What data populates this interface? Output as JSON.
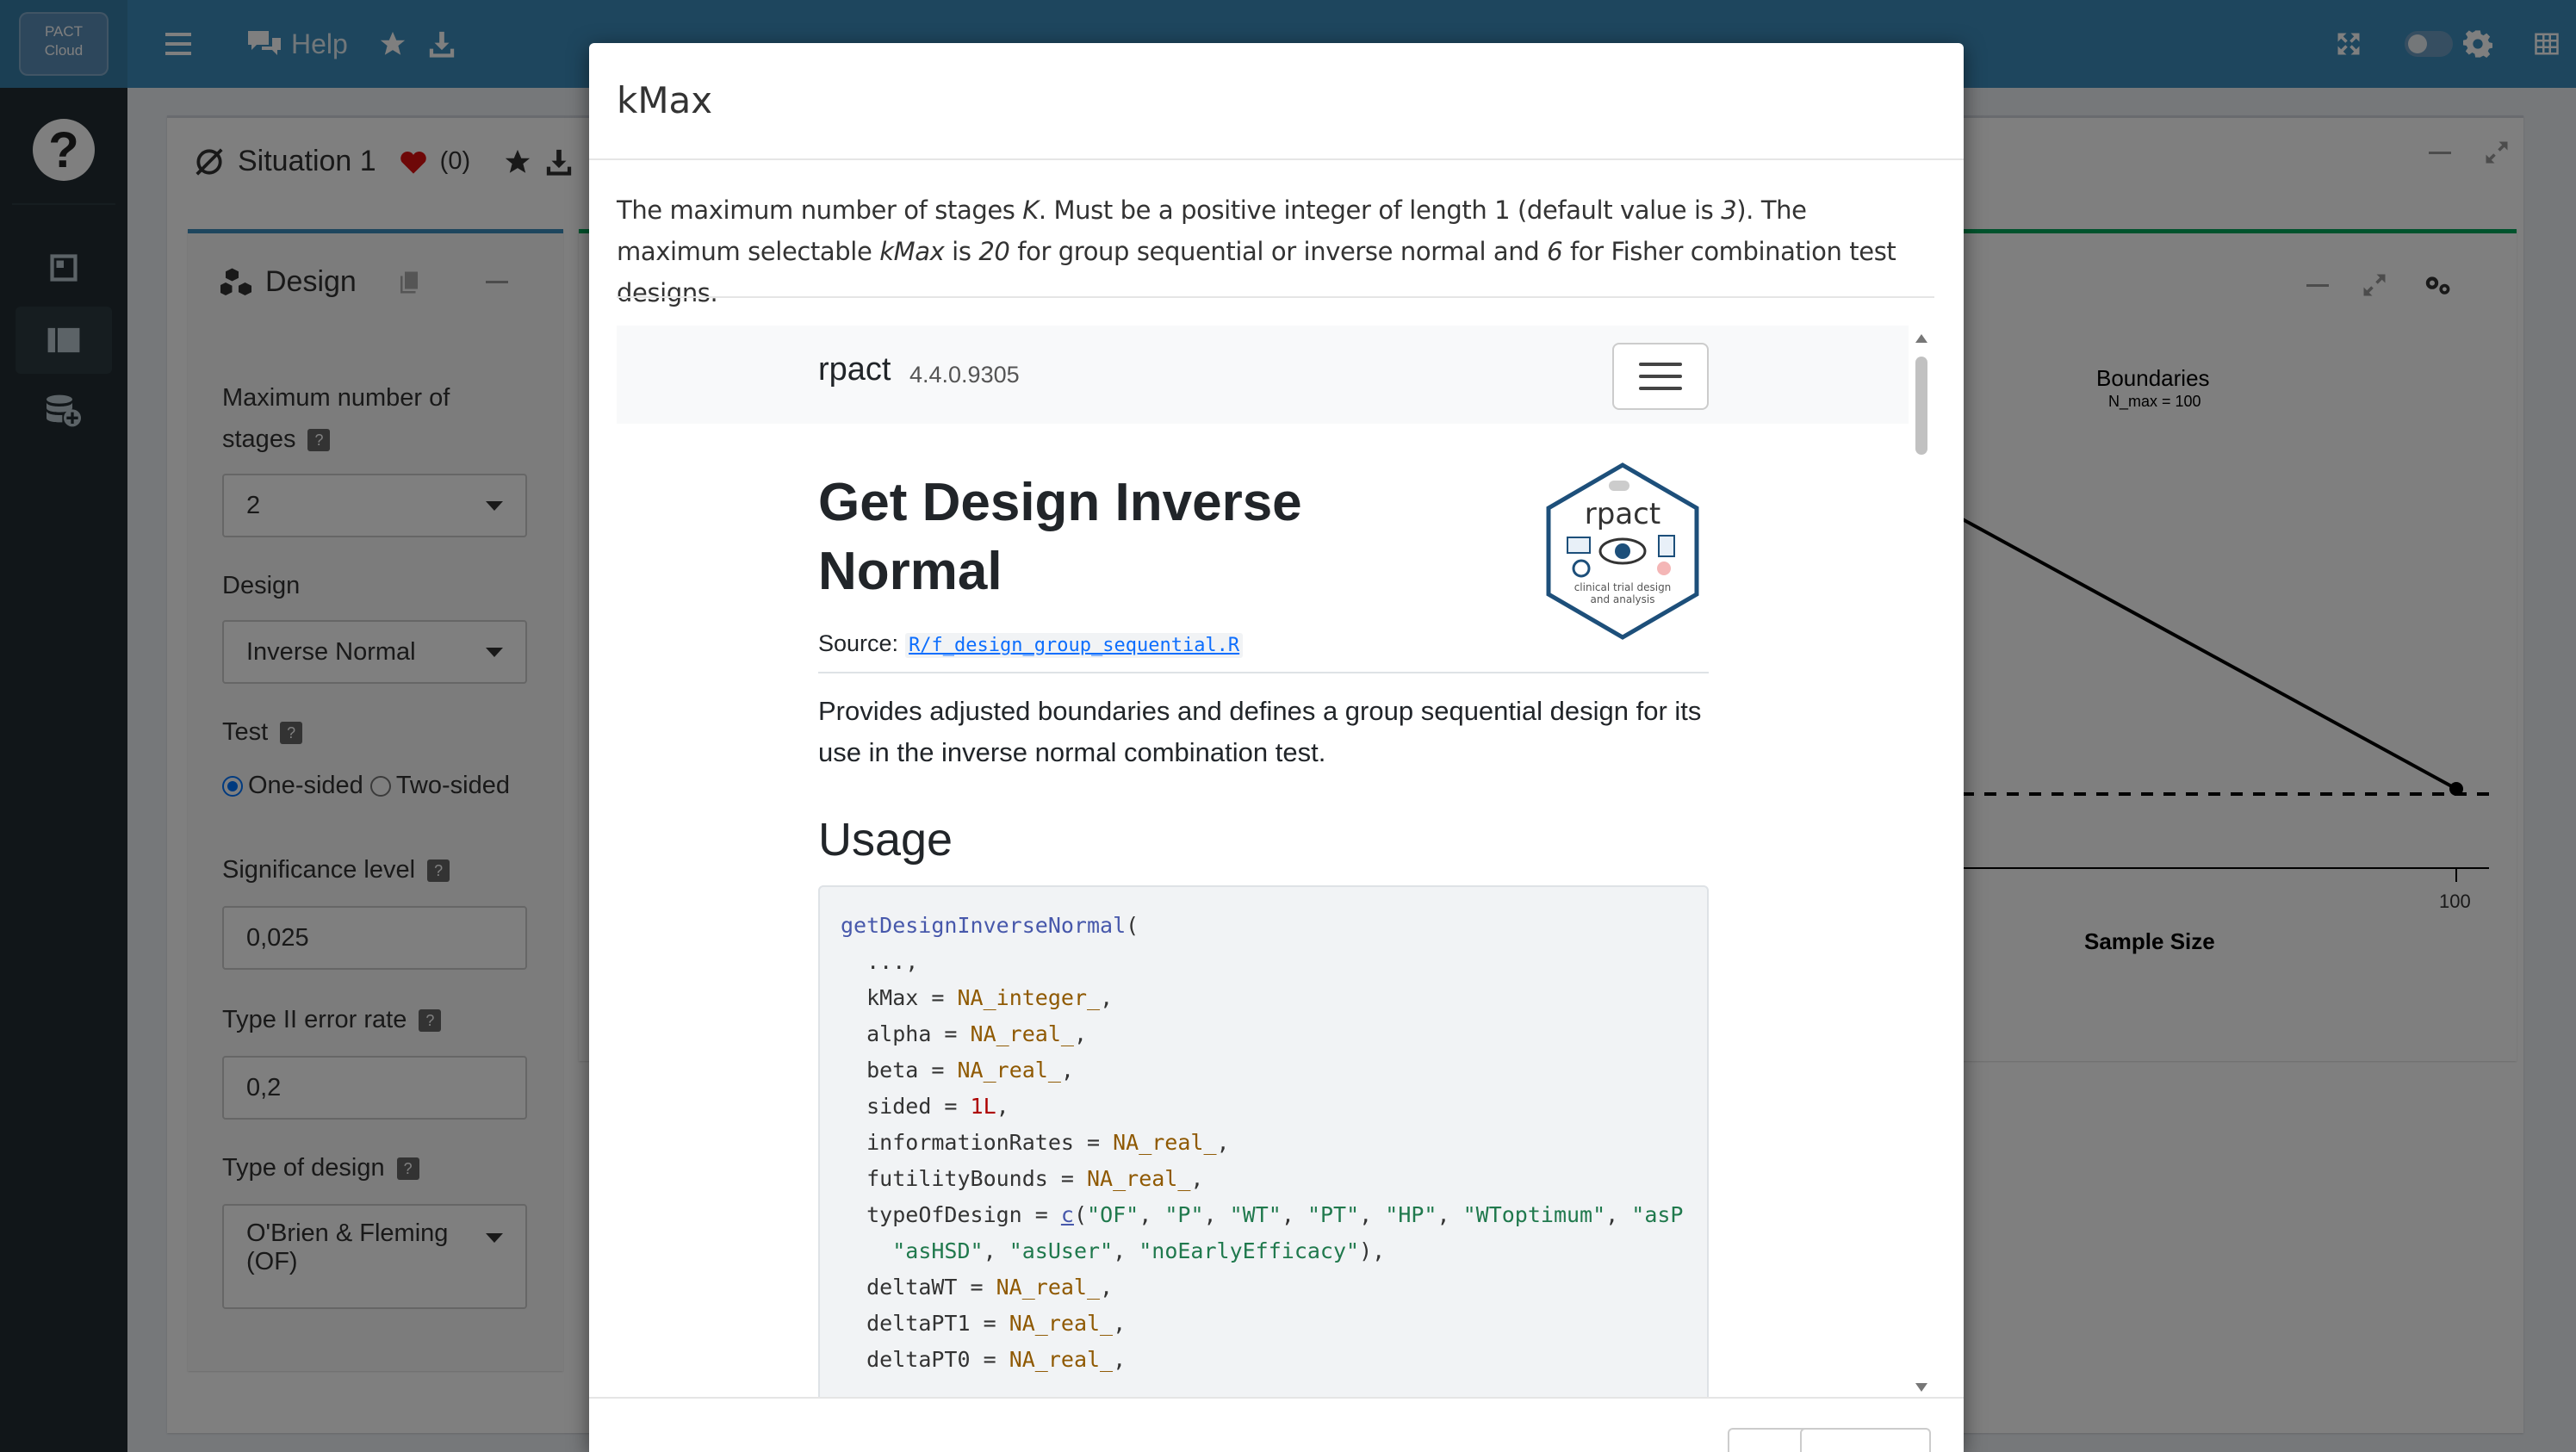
{
  "topbar": {
    "logo_line1": "PACT",
    "logo_line2": "Cloud",
    "help_label": "Help"
  },
  "situation": {
    "title": "Situation 1",
    "favorites_count": "(0)"
  },
  "design_panel": {
    "title": "Design",
    "max_stages_label": "Maximum number of stages",
    "max_stages_value": "2",
    "design_label": "Design",
    "design_value": "Inverse Normal",
    "test_label": "Test",
    "one_sided": "One-sided",
    "two_sided": "Two-sided",
    "sig_label": "Significance level",
    "sig_value": "0,025",
    "type2_label": "Type II error rate",
    "type2_value": "0,2",
    "type_design_label": "Type of design",
    "type_design_value": "O'Brien & Fleming (OF)",
    "help_mark": "?"
  },
  "plot_panel": {
    "title": "Boundaries",
    "subtitle": "N_max = 100",
    "xtick": "100",
    "xlabel": "Sample Size"
  },
  "modal": {
    "title": "kMax",
    "desc_1": "The maximum number of stages ",
    "desc_K": "K",
    "desc_2": ". Must be a positive integer of length 1 (default value is ",
    "desc_3val": "3",
    "desc_4": "). The maximum selectable ",
    "desc_kmax": "kMax",
    "desc_5": " is ",
    "desc_20": "20",
    "desc_6": " for group sequential or inverse normal and ",
    "desc_six": "6",
    "desc_7": " for Fisher combination test designs."
  },
  "docs": {
    "brand": "rpact",
    "version": "4.4.0.9305",
    "h1": "Get Design Inverse Normal",
    "source_label": "Source:",
    "source_link": "R/f_design_group_sequential.R",
    "description": "Provides adjusted boundaries and defines a group sequential design for its use in the inverse normal combination test.",
    "usage_heading": "Usage",
    "hex_name": "rpact",
    "hex_tag1": "clinical trial design",
    "hex_tag2": "and analysis"
  },
  "colors": {
    "navbar": "#3c8dbc",
    "sidebar": "#222d32",
    "accent_blue": "#0075ff"
  }
}
